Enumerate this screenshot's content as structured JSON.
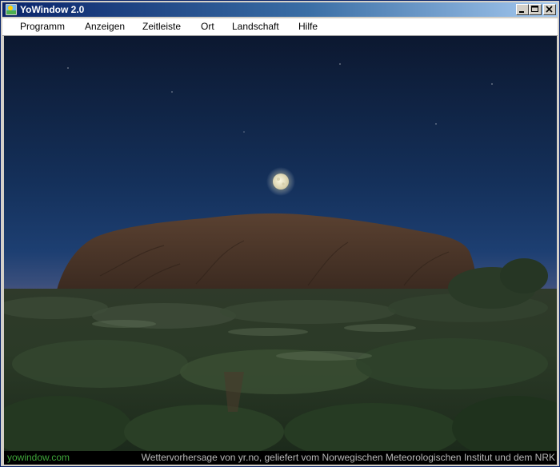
{
  "window": {
    "title": "YoWindow 2.0"
  },
  "menu": {
    "items": [
      {
        "label": "Programm"
      },
      {
        "label": "Anzeigen"
      },
      {
        "label": "Zeitleiste"
      },
      {
        "label": "Ort"
      },
      {
        "label": "Landschaft"
      },
      {
        "label": "Hilfe"
      }
    ]
  },
  "icons": {
    "app": "yowindow-app-icon",
    "minimize": "minimize-icon",
    "maximize": "maximize-icon",
    "close": "close-icon"
  },
  "status": {
    "link": "yowindow.com",
    "credit": "Wettervorhersage von yr.no, geliefert vom Norwegischen Meteorologischen Institut und dem NRK"
  },
  "colors": {
    "titlebar": "#0a246a",
    "sky_top": "#0d1a33",
    "sky_horizon": "#7a5a80",
    "rock": "#4a3528",
    "status_link": "#3fa63a"
  }
}
